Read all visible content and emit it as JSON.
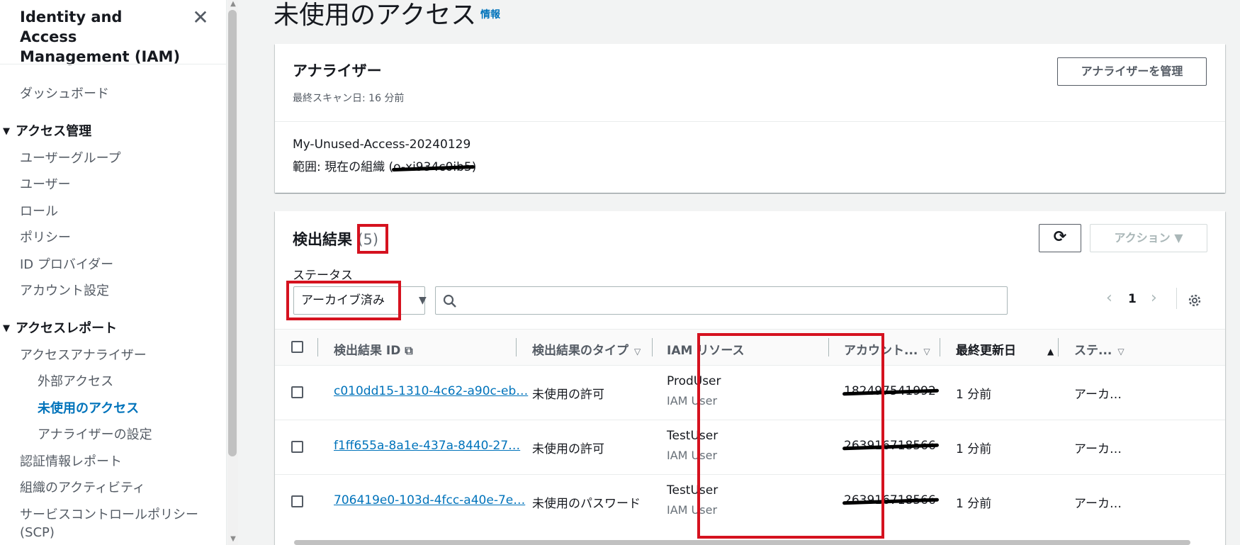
{
  "sidebar": {
    "title": "Identity and Access Management (IAM)",
    "close_glyph": "✕",
    "dashboard": "ダッシュボード",
    "access_mgmt": "アクセス管理",
    "mgmt_items": [
      "ユーザーグループ",
      "ユーザー",
      "ロール",
      "ポリシー",
      "ID プロバイダー",
      "アカウント設定"
    ],
    "access_reports": "アクセスレポート",
    "analyzer": "アクセスアナライザー",
    "analyzer_items": [
      "外部アクセス",
      "未使用のアクセス",
      "アナライザーの設定"
    ],
    "other_items": [
      "認証情報レポート",
      "組織のアクティビティ",
      "サービスコントロールポリシー",
      "(SCP)"
    ]
  },
  "page": {
    "title": "未使用のアクセス",
    "info": "情報"
  },
  "analyzer": {
    "heading": "アナライザー",
    "last_scan": "最終スキャン日: 16 分前",
    "manage_button": "アナライザーを管理",
    "name": "My-Unused-Access-20240129",
    "scope_prefix": "範囲: 現在の組織 (",
    "scope_org": "o-xi934c0ib5",
    "scope_suffix": ")"
  },
  "findings": {
    "heading": "検出結果",
    "count": "(5)",
    "refresh_glyph": "⟳",
    "action_button": "アクション ▼",
    "status_label": "ステータス",
    "status_value": "アーカイブ済み",
    "search_placeholder": "",
    "page": "1",
    "columns": {
      "id": "検出結果 ID",
      "type": "検出結果のタイプ",
      "resource": "IAM リソース",
      "account": "アカウント...",
      "updated": "最終更新日",
      "status": "ステ..."
    },
    "rows": [
      {
        "id": "c010dd15-1310-4c62-a90c-eb…",
        "type": "未使用の許可",
        "resource": "ProdUser",
        "resource_type": "IAM User",
        "account": "182497541992",
        "updated": "1 分前",
        "status": "アーカ…"
      },
      {
        "id": "f1ff655a-8a1e-437a-8440-27…",
        "type": "未使用の許可",
        "resource": "TestUser",
        "resource_type": "IAM User",
        "account": "263916718566",
        "updated": "1 分前",
        "status": "アーカ…"
      },
      {
        "id": "706419e0-103d-4fcc-a40e-7e…",
        "type": "未使用のパスワード",
        "resource": "TestUser",
        "resource_type": "IAM User",
        "account": "263916718566",
        "updated": "1 分前",
        "status": "アーカ…"
      }
    ]
  },
  "colors": {
    "link": "#0073bb",
    "highlight": "#d5121f"
  }
}
